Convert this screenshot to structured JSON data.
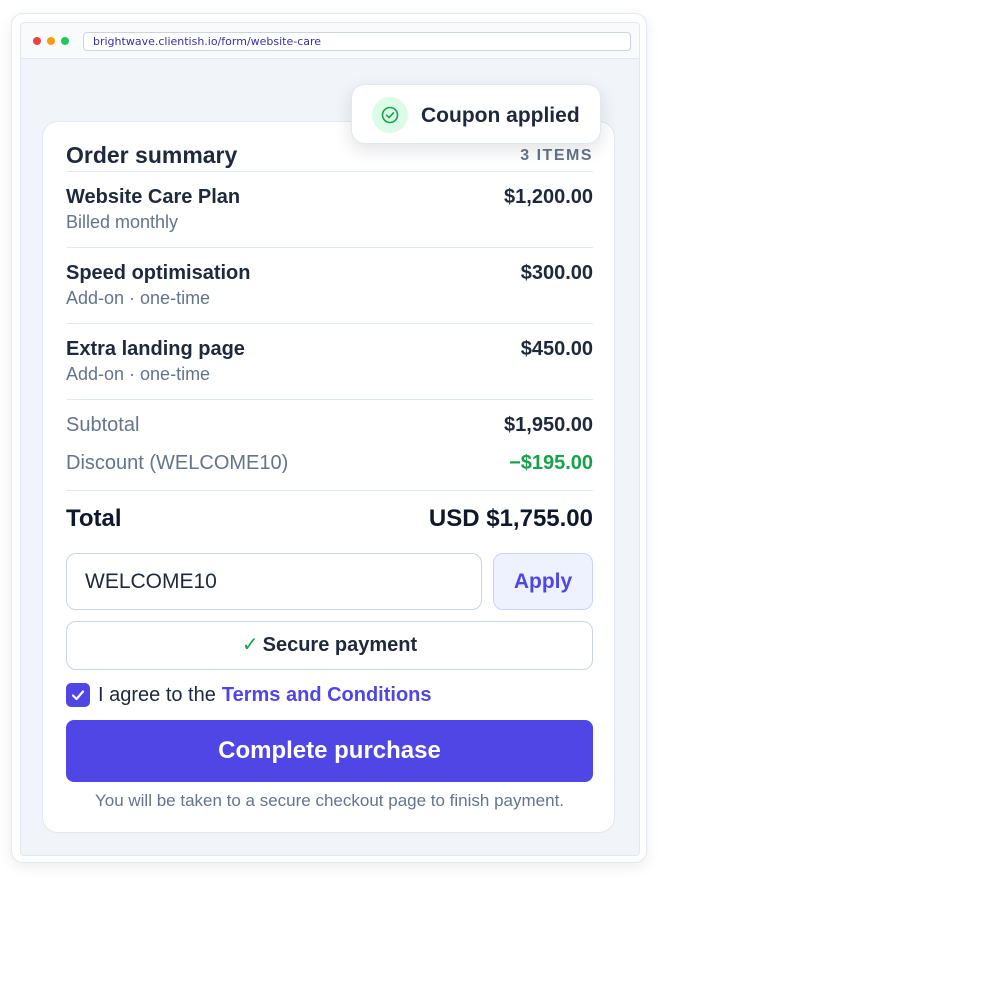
{
  "browser": {
    "url": "brightwave.clientish.io/form/website-care"
  },
  "toast": {
    "message": "Coupon applied",
    "icon": "check-circle-icon"
  },
  "order": {
    "title": "Order summary",
    "item_count": "3 ITEMS",
    "items": [
      {
        "name": "Website Care Plan",
        "subtitle": "Billed monthly",
        "price": "$1,200.00"
      },
      {
        "name": "Speed optimisation",
        "subtitle": "Add-on · one-time",
        "price": "$300.00"
      },
      {
        "name": "Extra landing page",
        "subtitle": "Add-on · one-time",
        "price": "$450.00"
      }
    ],
    "subtotal_label": "Subtotal",
    "subtotal_value": "$1,950.00",
    "discount_label": "Discount (WELCOME10)",
    "discount_value": "−$195.00",
    "total_label": "Total",
    "total_value": "USD $1,755.00"
  },
  "coupon": {
    "value": "WELCOME10",
    "apply_label": "Apply"
  },
  "secure": {
    "check": "✓",
    "label": "Secure payment"
  },
  "agreement": {
    "checked": true,
    "text": "I agree to the",
    "link_label": "Terms and Conditions"
  },
  "purchase": {
    "button_label": "Complete purchase",
    "footnote": "You will be taken to a secure checkout page to finish payment."
  },
  "colors": {
    "accent": "#4f46e5",
    "success": "#16a34a",
    "muted": "#64748b",
    "text": "#1e293b"
  }
}
